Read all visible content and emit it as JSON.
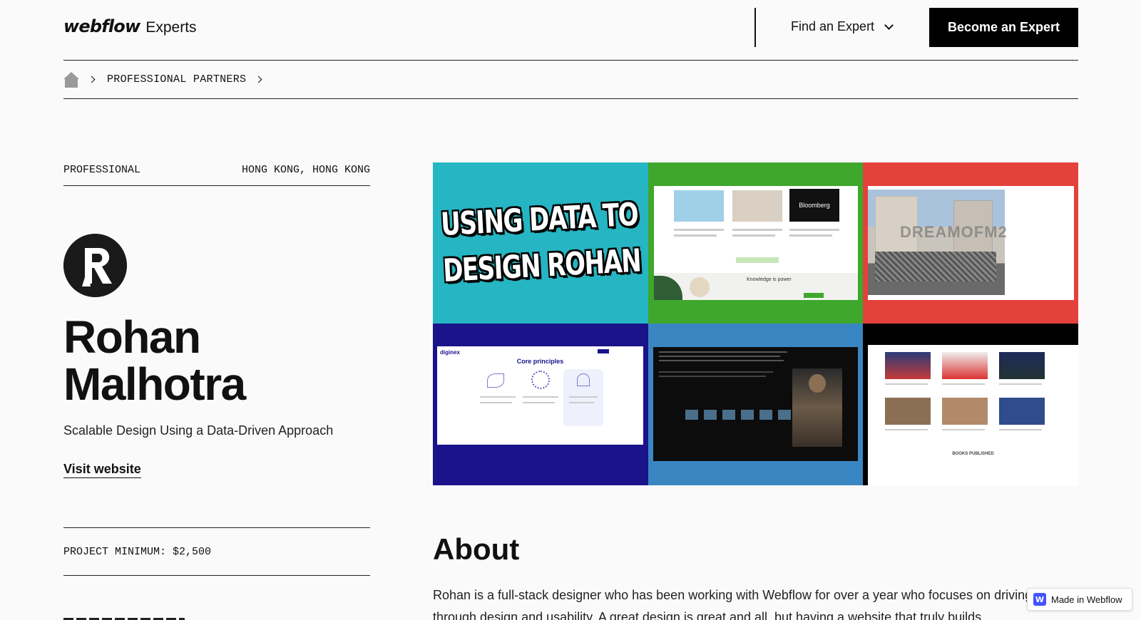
{
  "header": {
    "logo_mark": "webflow",
    "logo_sub": "Experts",
    "find_expert": "Find an Expert",
    "become_expert": "Become an Expert"
  },
  "breadcrumb": {
    "items": [
      "PROFESSIONAL PARTNERS"
    ]
  },
  "profile": {
    "tier": "PROFESSIONAL",
    "location": "HONG KONG, HONG KONG",
    "name": "Rohan Malhotra",
    "tagline": "Scalable Design Using a Data-Driven Approach",
    "visit_label": "Visit website",
    "project_minimum": "PROJECT MINIMUM: $2,500"
  },
  "gallery": {
    "tile1_text": "USING DATA TO DESIGN ROHAN",
    "tile2_brand": "Bloomberg",
    "tile2_caption": "Knowledge is power",
    "tile3_text": "DREAMOFM2",
    "tile4_title": "Core principles",
    "tile4_brand": "diginex",
    "tile6_footer": "BOOKS PUBLISHED"
  },
  "about": {
    "title": "About",
    "body": "Rohan is a full-stack designer who has been working with Webflow for over a year who focuses on driving growth through design and usability. A great design is great and all, but having a website that truly builds"
  },
  "badge": {
    "label": "Made in Webflow"
  },
  "colors": {
    "tile_teal": "#26b5c2",
    "tile_green": "#3ea72c",
    "tile_red": "#e4413b",
    "tile_navy": "#1a138a",
    "tile_blue": "#3a86c2",
    "tile_black": "#000000",
    "badge_blue": "#4353ff"
  }
}
